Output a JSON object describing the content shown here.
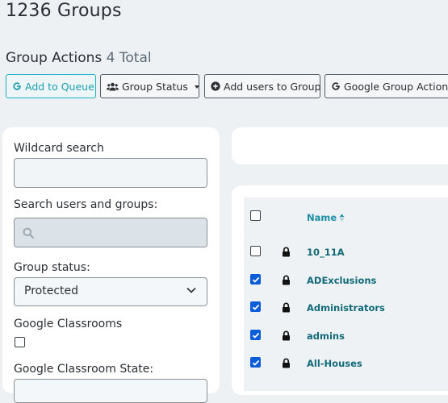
{
  "page": {
    "title": "1236 Groups"
  },
  "actions": {
    "title": "Group Actions",
    "total": "4 Total",
    "buttons": [
      {
        "label": "Add to Queue",
        "icon": "google-icon"
      },
      {
        "label": "Group Status",
        "icon": "users-icon"
      },
      {
        "label": "Add users to Group",
        "icon": "plus-circle-icon"
      },
      {
        "label": "Google Group Actions",
        "icon": "google-icon"
      }
    ]
  },
  "filters": {
    "wildcard_label": "Wildcard search",
    "wildcard_value": "",
    "search_label": "Search users and groups:",
    "search_value": "",
    "status_label": "Group status:",
    "status_value": "Protected",
    "classrooms_label": "Google Classrooms",
    "classroom_state_label": "Google Classroom State:"
  },
  "table": {
    "name_header": "Name",
    "rows": [
      {
        "name": "10_11A",
        "checked": false
      },
      {
        "name": "ADExclusions",
        "checked": true
      },
      {
        "name": "Administrators",
        "checked": true
      },
      {
        "name": "admins",
        "checked": true
      },
      {
        "name": "All-Houses",
        "checked": true
      }
    ]
  },
  "colors": {
    "accent": "#1bb3c3",
    "link": "#1c8fa5",
    "checkbox": "#0b5cd9"
  }
}
